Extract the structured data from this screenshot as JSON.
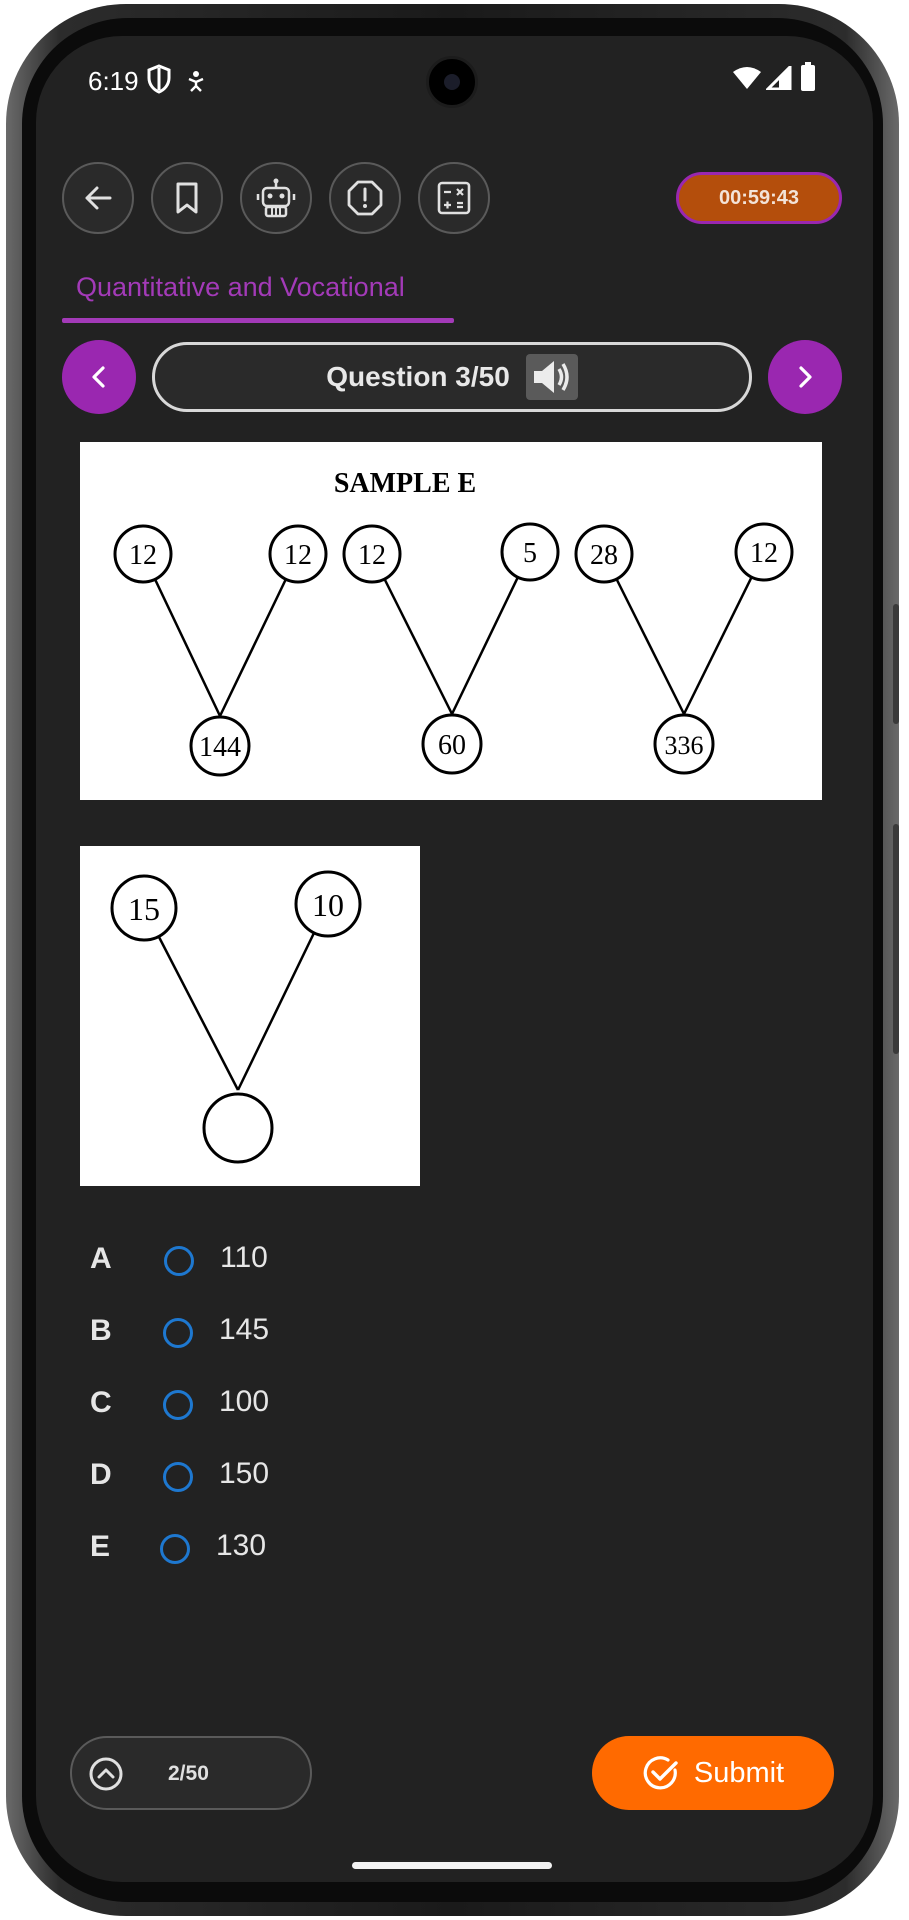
{
  "status_bar": {
    "time": "6:19"
  },
  "toolbar": {
    "buttons": [
      {
        "icon": "back-arrow-icon"
      },
      {
        "icon": "bookmark-icon"
      },
      {
        "icon": "robot-icon"
      },
      {
        "icon": "alert-octagon-icon"
      },
      {
        "icon": "calculator-icon"
      }
    ],
    "timer": "00:59:43"
  },
  "tab": {
    "label": "Quantitative and Vocational"
  },
  "question_nav": {
    "label": "Question 3/50",
    "prev_icon": "chevron-left-icon",
    "next_icon": "chevron-right-icon",
    "audio_icon": "speaker-icon"
  },
  "figure_sample": {
    "title": "SAMPLE E",
    "groups": [
      {
        "left": "12",
        "right": "12",
        "bottom": "144"
      },
      {
        "left": "12",
        "right": "5",
        "bottom": "60"
      },
      {
        "left": "28",
        "right": "12",
        "bottom": "336"
      }
    ]
  },
  "figure_question": {
    "left": "15",
    "right": "10",
    "bottom": ""
  },
  "options": [
    {
      "letter": "A",
      "value": "110"
    },
    {
      "letter": "B",
      "value": "145"
    },
    {
      "letter": "C",
      "value": "100"
    },
    {
      "letter": "D",
      "value": "150"
    },
    {
      "letter": "E",
      "value": "130"
    }
  ],
  "footer": {
    "progress": "2/50",
    "submit_label": "Submit"
  },
  "colors": {
    "accent_purple": "#9a27b0",
    "timer_bg": "#b44e0c",
    "submit_bg": "#ff6a00",
    "radio_blue": "#1e78d0"
  }
}
